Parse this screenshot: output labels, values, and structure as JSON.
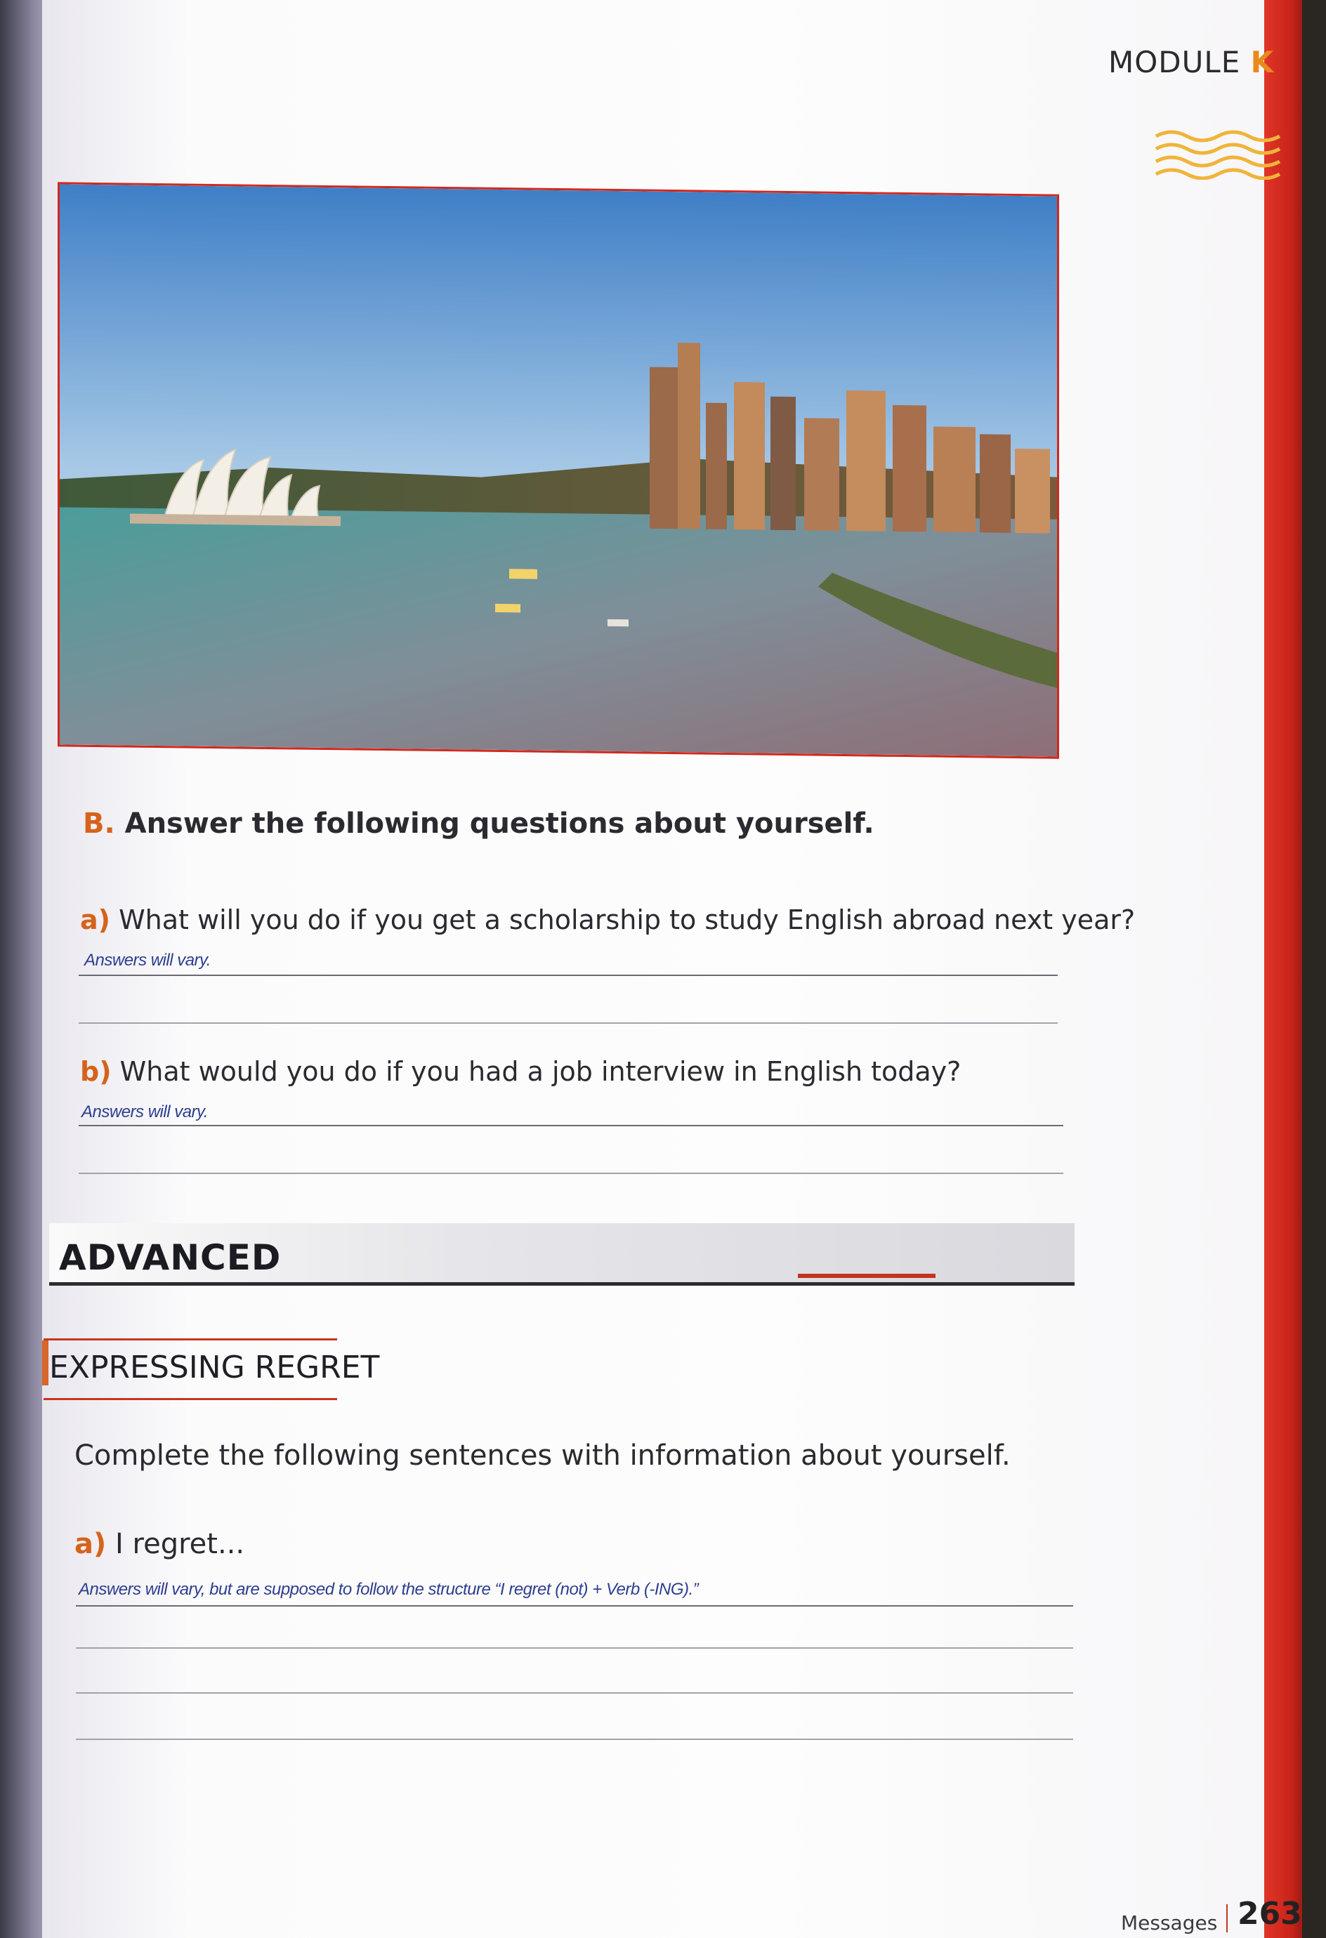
{
  "header": {
    "module_prefix": "MODULE ",
    "module_letter": "K"
  },
  "exercise_b": {
    "letter": "B.",
    "title": "Answer the following questions about yourself.",
    "questions": [
      {
        "letter": "a)",
        "text": "What will you do if you get a scholarship to study English abroad next year?",
        "answer": "Answers will vary."
      },
      {
        "letter": "b)",
        "text": "What would you do if you had a job interview in English today?",
        "answer": "Answers will vary."
      }
    ]
  },
  "section": {
    "label": "ADVANCED"
  },
  "subsection": {
    "label": "EXPRESSING REGRET",
    "instructions": "Complete the following sentences with information about yourself.",
    "items": [
      {
        "letter": "a)",
        "text": "I regret...",
        "answer": "Answers will vary, but are supposed to follow the structure “I regret (not) + Verb (-ING).”"
      }
    ]
  },
  "footer": {
    "partial_text": "Messages",
    "page_number": "263"
  },
  "colors": {
    "accent_red": "#c92419",
    "accent_orange": "#e88a1a",
    "answer_blue": "#2d3e8f"
  }
}
